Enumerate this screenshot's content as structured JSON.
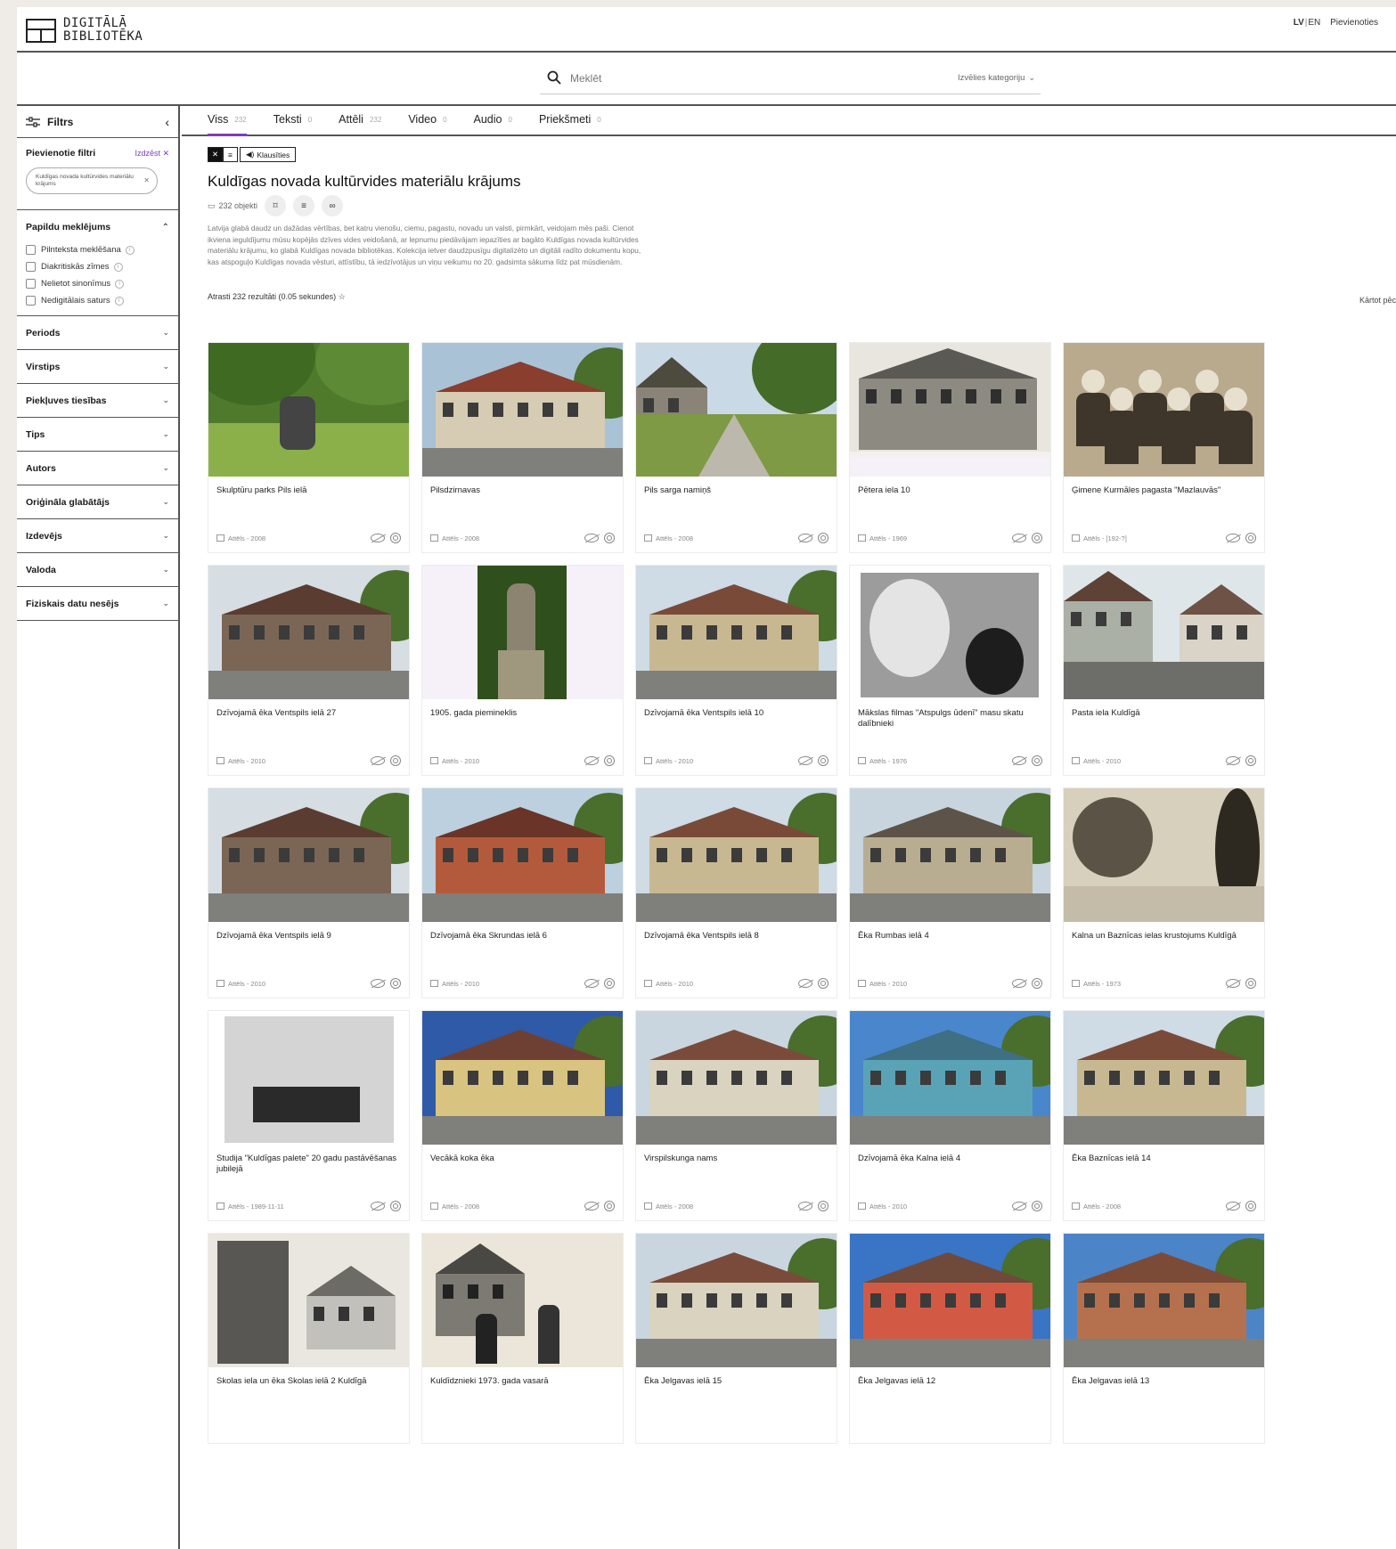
{
  "header": {
    "logo_line1": "DIGITĀLĀ",
    "logo_line2": "BIBLIOTĒKA",
    "lang_active": "LV",
    "lang_other": "EN",
    "login": "Pievienoties"
  },
  "search": {
    "placeholder": "Meklēt",
    "category": "Izvēlies kategoriju"
  },
  "sidebar": {
    "title": "Filtrs",
    "applied_title": "Pievienotie filtri",
    "clear": "Izdzēst",
    "chip": "Kuldīgas novada kultūrvides materiālu krājums",
    "advanced_title": "Papildu meklējums",
    "advanced_options": [
      "Pilnteksta meklēšana",
      "Diakritiskās zīmes",
      "Nelietot sinonīmus",
      "Nedigitālais saturs"
    ],
    "facets": [
      "Periods",
      "Virstips",
      "Piekļuves tiesības",
      "Tips",
      "Autors",
      "Oriģināla glabātājs",
      "Izdevējs",
      "Valoda",
      "Fiziskais datu nesējs"
    ]
  },
  "tabs": [
    {
      "label": "Viss",
      "count": "232"
    },
    {
      "label": "Teksti",
      "count": "0"
    },
    {
      "label": "Attēli",
      "count": "232"
    },
    {
      "label": "Video",
      "count": "0"
    },
    {
      "label": "Audio",
      "count": "0"
    },
    {
      "label": "Priekšmeti",
      "count": "0"
    }
  ],
  "collection": {
    "listen": "Klausīties",
    "title": "Kuldīgas novada kultūrvides materiālu krājums",
    "objects": "232 objekti",
    "description": "Latvija glabā daudz un dažādas vērtības, bet katru vienošu, ciemu, pagastu, novadu un valsti, pirmkārt, veidojam mēs paši. Cienot ikviena ieguldījumu mūsu kopējās dzīves vides veidošanā, ar lepnumu piedāvājam iepazīties ar bagāto Kuldīgas novada kultūrvides materiālu krājumu, ko glabā Kuldīgas novada bibliotēkas. Kolekcija ietver daudzpusīgu digitalizēto un digitāli radīto dokumentu kopu, kas atspoguļo Kuldīgas novada vēsturi, attīstību, tā iedzīvotājus un viņu veikumu no 20. gadsimta sākuma līdz pat mūsdienām.",
    "results": "Atrasti 232 rezultāti (0.05 sekundes)",
    "sort": "Kārtot pēc"
  },
  "cards": [
    {
      "title": "Skulptūru parks Pils ielā",
      "meta": "Attēls - 2008",
      "scene": "park"
    },
    {
      "title": "Pilsdzirnavas",
      "meta": "Attēls - 2008",
      "scene": "house-color"
    },
    {
      "title": "Pils sarga namiņš",
      "meta": "Attēls - 2008",
      "scene": "road"
    },
    {
      "title": "Pētera iela 10",
      "meta": "Attēls - 1969",
      "scene": "bw-winter"
    },
    {
      "title": "Ģimene Kurmāles pagasta \"Mazlauvās\"",
      "meta": "Attēls - [192-?]",
      "scene": "sepia-people"
    },
    {
      "title": "Dzīvojamā ēka Ventspils ielā 27",
      "meta": "Attēls - 2010",
      "scene": "house-wood"
    },
    {
      "title": "1905. gada piemineklis",
      "meta": "Attēls - 2010",
      "scene": "monument"
    },
    {
      "title": "Dzīvojamā ēka Ventspils ielā 10",
      "meta": "Attēls - 2010",
      "scene": "house-beige"
    },
    {
      "title": "Mākslas filmas \"Atspulgs ūdenī\" masu skatu dalībnieki",
      "meta": "Attēls - 1976",
      "scene": "bw-portrait"
    },
    {
      "title": "Pasta iela Kuldīgā",
      "meta": "Attēls - 2010",
      "scene": "street"
    },
    {
      "title": "Dzīvojamā ēka Ventspils ielā 9",
      "meta": "Attēls - 2010",
      "scene": "house-wood"
    },
    {
      "title": "Dzīvojamā ēka Skrundas ielā 6",
      "meta": "Attēls - 2010",
      "scene": "house-red"
    },
    {
      "title": "Dzīvojamā ēka Ventspils ielā 8",
      "meta": "Attēls - 2010",
      "scene": "house-beige"
    },
    {
      "title": "Ēka Rumbas ielā 4",
      "meta": "Attēls - 2010",
      "scene": "house-stone"
    },
    {
      "title": "Kalna un Baznīcas ielas krustojums Kuldīgā",
      "meta": "Attēls - 1973",
      "scene": "sepia-street"
    },
    {
      "title": "Studija \"Kuldīgas palete\" 20 gadu pastāvēšanas jubilejā",
      "meta": "Attēls - 1989-11-11",
      "scene": "bw-group"
    },
    {
      "title": "Vecākā koka ēka",
      "meta": "Attēls - 2008",
      "scene": "house-yellow"
    },
    {
      "title": "Virspilskunga nams",
      "meta": "Attēls - 2008",
      "scene": "house-long"
    },
    {
      "title": "Dzīvojamā ēka Kalna ielā 4",
      "meta": "Attēls - 2010",
      "scene": "house-blue"
    },
    {
      "title": "Ēka Baznīcas ielā 14",
      "meta": "Attēls - 2008",
      "scene": "house-beige"
    },
    {
      "title": "Skolas iela un ēka Skolas ielā 2 Kuldīgā",
      "meta": "",
      "scene": "bw-street"
    },
    {
      "title": "Kuldīdznieki 1973. gada vasarā",
      "meta": "",
      "scene": "bw-street2"
    },
    {
      "title": "Ēka Jelgavas ielā 15",
      "meta": "",
      "scene": "house-long"
    },
    {
      "title": "Ēka Jelgavas ielā 12",
      "meta": "",
      "scene": "house-redwhite"
    },
    {
      "title": "Ēka Jelgavas ielā 13",
      "meta": "",
      "scene": "house-brick"
    }
  ]
}
